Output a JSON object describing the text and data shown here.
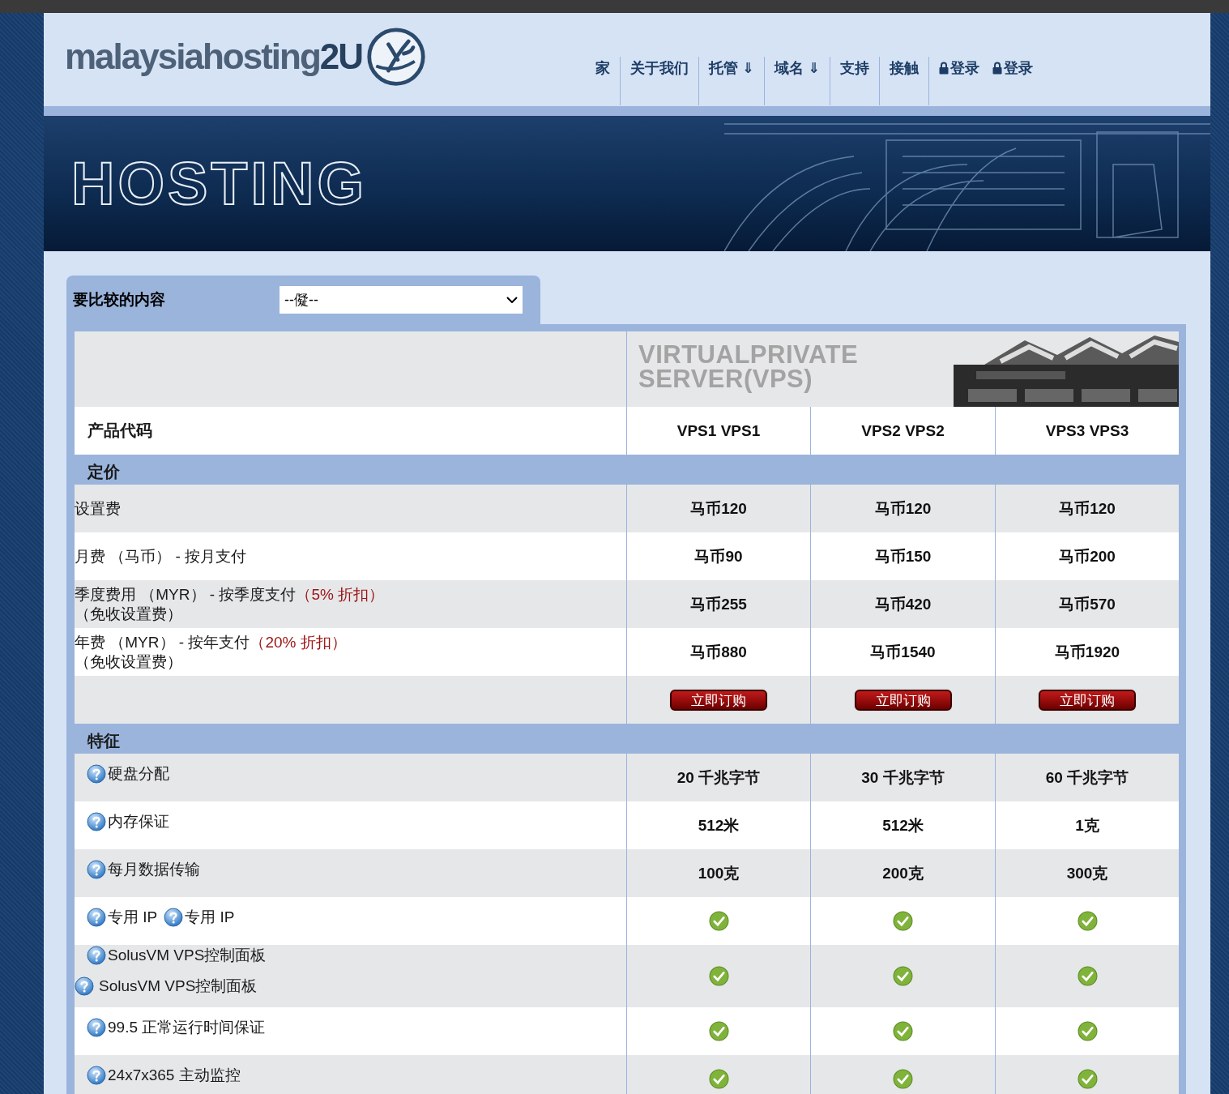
{
  "logo": {
    "text": "malaysiahosting",
    "accent": "2U"
  },
  "nav": [
    {
      "label": "家",
      "kind": "text"
    },
    {
      "label": "关于我们",
      "kind": "text"
    },
    {
      "label": "托管 ⇓",
      "kind": "text"
    },
    {
      "label": "域名 ⇓",
      "kind": "text"
    },
    {
      "label": "支持",
      "kind": "text"
    },
    {
      "label": "接触",
      "kind": "text"
    },
    {
      "label": "登录",
      "kind": "lock"
    },
    {
      "label": "登录",
      "kind": "lock"
    }
  ],
  "banner": {
    "title": "HOSTING"
  },
  "compare": {
    "label": "要比较的内容",
    "value": "--儗--"
  },
  "table": {
    "image_text": [
      "VIRTUALPRIVATE",
      "SERVER(VPS)"
    ],
    "code_label": "产品代码",
    "columns": [
      "VPS1 VPS1",
      "VPS2 VPS2",
      "VPS3 VPS3"
    ],
    "sections": [
      {
        "title": "定价",
        "rows": [
          {
            "kind": "plain",
            "label": "设置费",
            "cells": [
              {
                "kind": "text",
                "text": "马币120"
              },
              {
                "kind": "text",
                "text": "马币120"
              },
              {
                "kind": "text",
                "text": "马币120"
              }
            ]
          },
          {
            "kind": "plain",
            "label": "月费 （马币） - 按月支付",
            "cells": [
              {
                "kind": "text",
                "text": "马币90"
              },
              {
                "kind": "text",
                "text": "马币150"
              },
              {
                "kind": "text",
                "text": "马币200"
              }
            ]
          },
          {
            "kind": "plain",
            "label": "季度费用 （MYR） - 按季度支付",
            "discount": "（5% 折扣）",
            "note": "（免收设置费）",
            "cells": [
              {
                "kind": "text",
                "text": "马币255"
              },
              {
                "kind": "text",
                "text": "马币420"
              },
              {
                "kind": "text",
                "text": "马币570"
              }
            ]
          },
          {
            "kind": "plain",
            "label": "年费 （MYR） - 按年支付",
            "discount": "（20% 折扣）",
            "note": "（免收设置费）",
            "cells": [
              {
                "kind": "text",
                "text": "马币880"
              },
              {
                "kind": "text",
                "text": "马币1540"
              },
              {
                "kind": "text",
                "text": "马币1920"
              }
            ]
          },
          {
            "kind": "plain",
            "cells": [
              {
                "kind": "button",
                "text": "立即订购"
              },
              {
                "kind": "button",
                "text": "立即订购"
              },
              {
                "kind": "button",
                "text": "立即订购"
              }
            ]
          }
        ]
      },
      {
        "title": "特征",
        "rows": [
          {
            "kind": "help",
            "labels": [
              "硬盘分配"
            ],
            "cells": [
              {
                "kind": "text",
                "text": "20 千兆字节"
              },
              {
                "kind": "text",
                "text": "30 千兆字节"
              },
              {
                "kind": "text",
                "text": "60 千兆字节"
              }
            ]
          },
          {
            "kind": "help",
            "labels": [
              "内存保证"
            ],
            "cells": [
              {
                "kind": "text",
                "text": "512米"
              },
              {
                "kind": "text",
                "text": "512米"
              },
              {
                "kind": "text",
                "text": "1克"
              }
            ]
          },
          {
            "kind": "help",
            "labels": [
              "每月数据传输"
            ],
            "cells": [
              {
                "kind": "text",
                "text": "100克"
              },
              {
                "kind": "text",
                "text": "200克"
              },
              {
                "kind": "text",
                "text": "300克"
              }
            ]
          },
          {
            "kind": "help",
            "labels": [
              "专用 IP",
              "专用 IP"
            ],
            "cells": [
              {
                "kind": "check",
                "checked": true
              },
              {
                "kind": "check",
                "checked": true
              },
              {
                "kind": "check",
                "checked": true
              }
            ]
          },
          {
            "kind": "stacked",
            "labels": [
              "SolusVM VPS控制面板",
              "SolusVM VPS控制面板"
            ],
            "cells": [
              {
                "kind": "check",
                "checked": true
              },
              {
                "kind": "check",
                "checked": true
              },
              {
                "kind": "check",
                "checked": true
              }
            ]
          },
          {
            "kind": "help",
            "labels": [
              "99.5 正常运行时间保证"
            ],
            "cells": [
              {
                "kind": "check",
                "checked": true
              },
              {
                "kind": "check",
                "checked": true
              },
              {
                "kind": "check",
                "checked": true
              }
            ]
          },
          {
            "kind": "help",
            "labels": [
              "24x7x365 主动监控"
            ],
            "cells": [
              {
                "kind": "check",
                "checked": true
              },
              {
                "kind": "check",
                "checked": true
              },
              {
                "kind": "check",
                "checked": true
              }
            ]
          }
        ]
      }
    ]
  }
}
